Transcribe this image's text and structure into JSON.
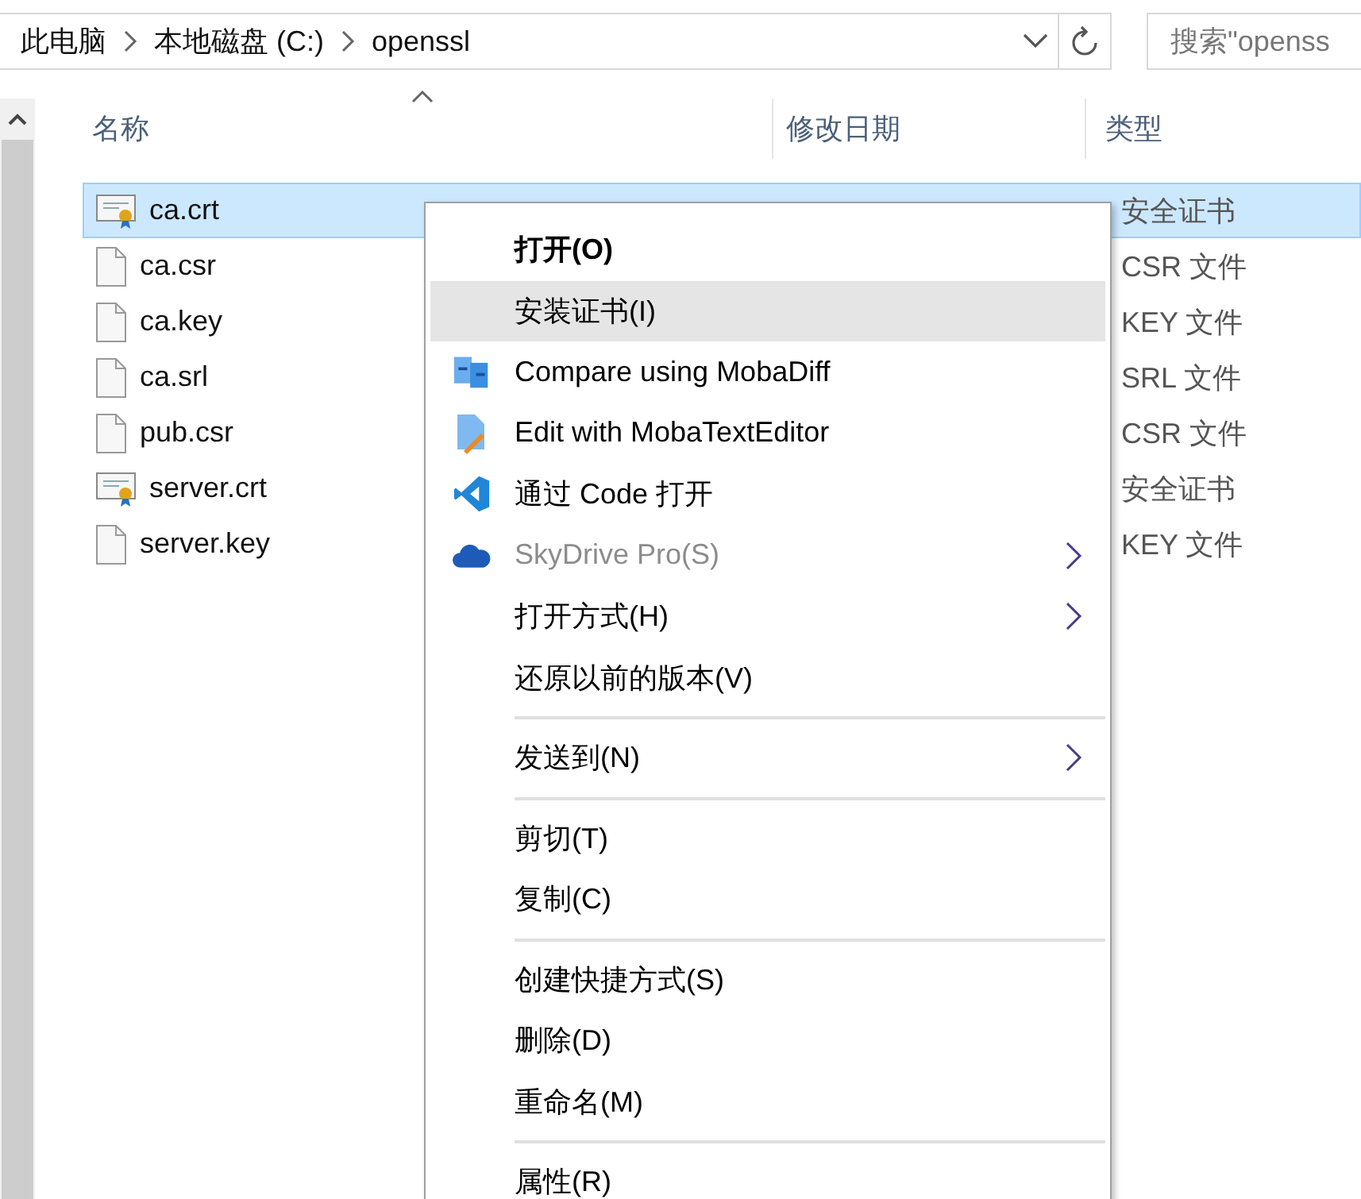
{
  "address_bar": {
    "breadcrumbs": [
      "此电脑",
      "本地磁盘 (C:)",
      "openssl"
    ]
  },
  "search": {
    "placeholder": "搜索\"openss"
  },
  "columns": [
    {
      "label": "名称",
      "sorted": true
    },
    {
      "label": "修改日期",
      "sorted": false
    },
    {
      "label": "类型",
      "sorted": false
    }
  ],
  "files": [
    {
      "name": "ca.crt",
      "kind": "certificate",
      "type": "安全证书",
      "selected": true
    },
    {
      "name": "ca.csr",
      "kind": "file",
      "type": "CSR 文件",
      "selected": false
    },
    {
      "name": "ca.key",
      "kind": "file",
      "type": "KEY 文件",
      "selected": false
    },
    {
      "name": "ca.srl",
      "kind": "file",
      "type": "SRL 文件",
      "selected": false
    },
    {
      "name": "pub.csr",
      "kind": "file",
      "type": "CSR 文件",
      "selected": false
    },
    {
      "name": "server.crt",
      "kind": "certificate",
      "type": "安全证书",
      "selected": false
    },
    {
      "name": "server.key",
      "kind": "file",
      "type": "KEY 文件",
      "selected": false
    }
  ],
  "context_menu": [
    {
      "kind": "plain",
      "label": "打开(O)",
      "default": true,
      "highlighted": false,
      "disabled": false,
      "submenu": false
    },
    {
      "kind": "plain",
      "label": "安装证书(I)",
      "default": false,
      "highlighted": true,
      "disabled": false,
      "submenu": false
    },
    {
      "kind": "diff",
      "label": "Compare using MobaDiff",
      "default": false,
      "highlighted": false,
      "disabled": false,
      "submenu": false
    },
    {
      "kind": "editor",
      "label": "Edit with MobaTextEditor",
      "default": false,
      "highlighted": false,
      "disabled": false,
      "submenu": false
    },
    {
      "kind": "code",
      "label": "通过 Code 打开",
      "default": false,
      "highlighted": false,
      "disabled": false,
      "submenu": false
    },
    {
      "kind": "cloud",
      "label": "SkyDrive Pro(S)",
      "default": false,
      "highlighted": false,
      "disabled": true,
      "submenu": true
    },
    {
      "kind": "plain",
      "label": "打开方式(H)",
      "default": false,
      "highlighted": false,
      "disabled": false,
      "submenu": true
    },
    {
      "kind": "plain",
      "label": "还原以前的版本(V)",
      "default": false,
      "highlighted": false,
      "disabled": false,
      "submenu": false
    },
    {
      "kind": "separator"
    },
    {
      "kind": "plain",
      "label": "发送到(N)",
      "default": false,
      "highlighted": false,
      "disabled": false,
      "submenu": true
    },
    {
      "kind": "separator"
    },
    {
      "kind": "plain",
      "label": "剪切(T)",
      "default": false,
      "highlighted": false,
      "disabled": false,
      "submenu": false
    },
    {
      "kind": "plain",
      "label": "复制(C)",
      "default": false,
      "highlighted": false,
      "disabled": false,
      "submenu": false
    },
    {
      "kind": "separator"
    },
    {
      "kind": "plain",
      "label": "创建快捷方式(S)",
      "default": false,
      "highlighted": false,
      "disabled": false,
      "submenu": false
    },
    {
      "kind": "plain",
      "label": "删除(D)",
      "default": false,
      "highlighted": false,
      "disabled": false,
      "submenu": false
    },
    {
      "kind": "plain",
      "label": "重命名(M)",
      "default": false,
      "highlighted": false,
      "disabled": false,
      "submenu": false
    },
    {
      "kind": "separator"
    },
    {
      "kind": "plain",
      "label": "属性(R)",
      "default": false,
      "highlighted": false,
      "disabled": false,
      "submenu": false
    }
  ]
}
